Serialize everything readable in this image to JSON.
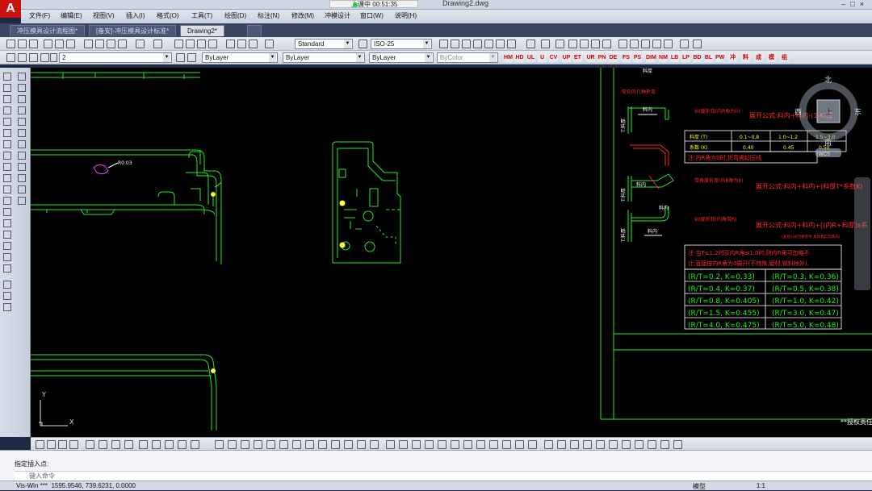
{
  "window": {
    "title": "Drawing2.dwg",
    "recording_status": "上课中 00:51:35",
    "app_icon_label": "A"
  },
  "menu": [
    "文件(F)",
    "编辑(E)",
    "视图(V)",
    "插入(I)",
    "格式(O)",
    "工具(T)",
    "绘图(D)",
    "标注(N)",
    "修改(M)",
    "冲模设计",
    "窗口(W)",
    "说明(H)"
  ],
  "tabs": [
    {
      "label": "冲压模具设计流程图*",
      "active": false
    },
    {
      "label": "[备安]-冲压模具设计标准*",
      "active": false
    },
    {
      "label": "Drawing2*",
      "active": true
    }
  ],
  "toolbar": {
    "text_style": "Standard",
    "dim_style": "ISO-25",
    "layer": "2",
    "color": "ByLayer",
    "linetype": "ByLayer",
    "lineweight": "ByLayer",
    "plot_style": "ByColor",
    "custom_buttons": [
      "HM",
      "HD",
      "UL",
      "U",
      "CV",
      "UP",
      "ET",
      "UR",
      "PN",
      "DE",
      "FS",
      "PS",
      "DIM",
      "NM",
      "LB",
      "LP",
      "BD",
      "BL",
      "PW",
      "冲",
      "料",
      "成",
      "模",
      "组"
    ]
  },
  "drawing": {
    "dim_label": "R0.03",
    "bend_section_title": "常见的几种折弯:",
    "bend_90_label": "90度折弯(内R角为0)",
    "formula_1": "展开公式:料内+料内-(1-K)厚",
    "thickness_table": {
      "header_t": "料厚 (T)",
      "header_k": "系数 (K)",
      "cols_t": [
        "0.1~0.8",
        "1.0~1.2",
        "1.5~3.0"
      ],
      "cols_k": [
        "0.40",
        "0.45",
        "0.50"
      ]
    },
    "note_1": "注:内R角为0时,折弯需起压线.",
    "bend_angle_label": "带角度折弯(内R角为0)",
    "formula_2": "展开公式:料内+料内+(料厚T*系数K)",
    "bend_r_label": "90度折弯(内角带R)",
    "formula_3": "展开公式:料内+料内+[(内R+料厚)x系",
    "formula_3_note": "(此处公式仅做参考,具体看实际情况)",
    "note_2_line1": "注:当T≤1.2时及内R角≤1.0时,则内R角可忽略不",
    "note_2_line2": "计,直接按内R角为0展开(不特殊,钣材,钢料除外).",
    "rt_table": [
      [
        "(R/T=0.2, K=0.33)",
        "(R/T=0.3, K=0.36)"
      ],
      [
        "(R/T=0.4, K=0.37)",
        "(R/T=0.5, K=0.38)"
      ],
      [
        "(R/T=0.8, K=0.405)",
        "(R/T=1.0, K=0.42)"
      ],
      [
        "(R/T=1.5, K=0.455)",
        "(R/T=3.0, K=0.47)"
      ],
      [
        "(R/T=4.0, K=0.475)",
        "(R/T=5.0, K=0.48)"
      ]
    ],
    "thickness_label": "料厚",
    "inner_label": "料内",
    "t_label": "T:料厚",
    "bottom_right_text": "**授权责任",
    "compass": {
      "north": "北",
      "south": "南",
      "east": "东",
      "west": "西",
      "center": "上",
      "wcs": "WCS"
    },
    "ucs_x": "X",
    "ucs_y": "Y"
  },
  "command": {
    "history": "指定插入点:",
    "prompt": "键入命令"
  },
  "status": {
    "coords": "1595.9546, 739.6231, 0.0000",
    "prefix": "Vis-Win ***",
    "model": "模型",
    "scale": "1:1"
  },
  "colors": {
    "drawing_green": "#22ee22",
    "drawing_red": "#ff2a2a",
    "drawing_yellow": "#ffff33",
    "drawing_white": "#ffffff",
    "magenta": "#ff44ff",
    "cyan": "#33dddd"
  }
}
